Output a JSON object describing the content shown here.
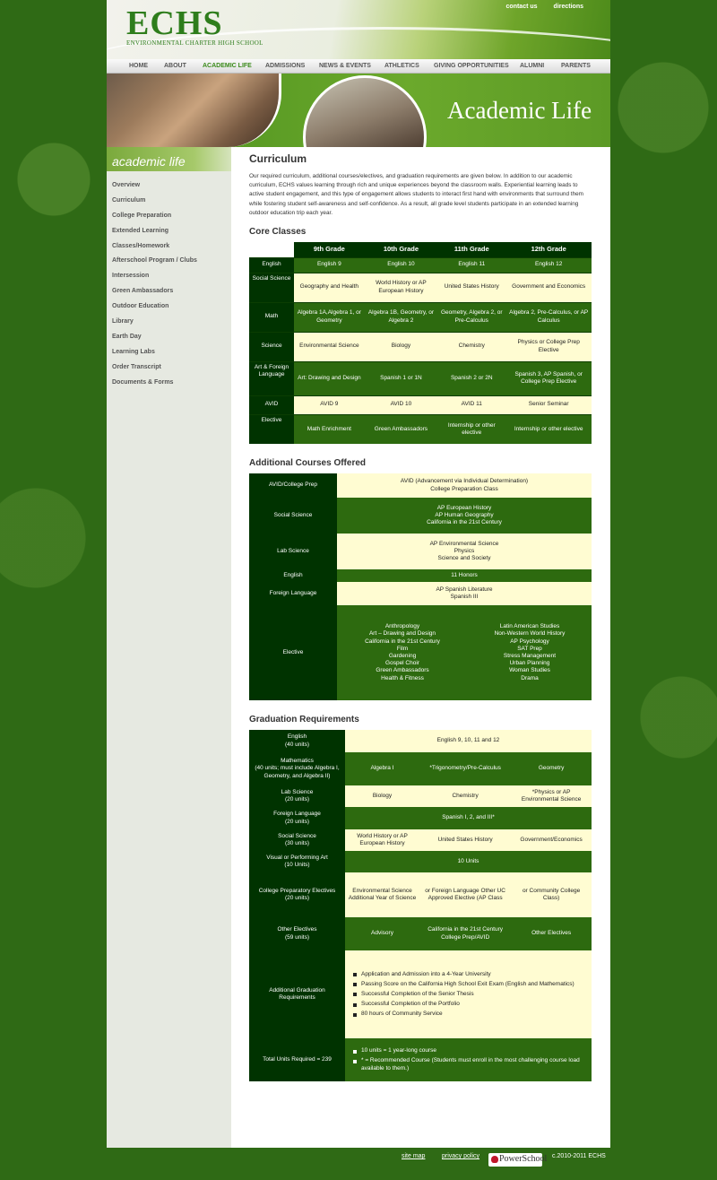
{
  "header": {
    "logo_text": "ECHS",
    "logo_sub": "ENVIRONMENTAL CHARTER HIGH SCHOOL",
    "util_nav": [
      "contact us",
      "directions"
    ]
  },
  "nav": [
    "HOME",
    "ABOUT",
    "ACADEMIC LIFE",
    "ADMISSIONS",
    "NEWS & EVENTS",
    "ATHLETICS",
    "GIVING OPPORTUNITIES",
    "ALUMNI",
    "PARENTS"
  ],
  "banner": {
    "title": "Academic Life"
  },
  "sidebar": {
    "title": "academic life",
    "items": [
      "Overview",
      "Curriculum",
      "College Preparation",
      "Extended Learning",
      "Classes/Homework",
      "Afterschool Program / Clubs",
      "Intersession",
      "Green Ambassadors",
      "Outdoor Education",
      "Library",
      "Earth Day",
      "Learning Labs",
      "Order Transcript",
      "Documents & Forms"
    ]
  },
  "curriculum": {
    "title": "Curriculum",
    "intro": "Our required curriculum, additional courses/electives, and graduation requirements are given below. In addition to our academic curriculum, ECHS values learning through rich and unique experiences beyond the classroom walls.   Experiential learning leads to active student engagement, and this type of engagement allows students to interact first hand with environments that surround them while fostering student self-awareness and self-confidence. As a result, all grade level students participate in an extended learning outdoor education trip each year."
  },
  "core": {
    "title": "Core Classes",
    "grades": [
      "9th Grade",
      "10th Grade",
      "11th Grade",
      "12th Grade"
    ],
    "rows": [
      {
        "subject": "English",
        "cells": [
          "English 9",
          "English 10",
          "English 11",
          "English 12"
        ]
      },
      {
        "subject": "Social Science",
        "cells": [
          "Geography and Health",
          "World History or AP European History",
          "United States History",
          "Government and Economics"
        ]
      },
      {
        "subject": "Math",
        "cells": [
          "Algebra 1A,Algebra 1, or Geometry",
          "Algebra 1B, Geometry, or Algebra 2",
          "Geometry, Algebra 2, or Pre-Calculus",
          "Algebra 2, Pre-Calculus, or AP Calculus"
        ]
      },
      {
        "subject": "Science",
        "cells": [
          "Environmental Science",
          "Biology",
          "Chemistry",
          "Physics or College Prep Elective"
        ]
      },
      {
        "subject": "Art & Foreign Language",
        "cells": [
          "Art: Drawing and Design",
          "Spanish 1 or 1N",
          "Spanish 2 or 2N",
          "Spanish 3, AP Spanish, or College Prep Elective"
        ]
      },
      {
        "subject": "AVID",
        "cells": [
          "AVID 9",
          "AVID 10",
          "AVID 11",
          "Senior Seminar"
        ]
      },
      {
        "subject": "Elective",
        "cells": [
          "Math Enrichment",
          "Green Ambassadors",
          "Internship or other elective",
          "Internship or other elective"
        ]
      }
    ]
  },
  "additional": {
    "title": "Additional Courses Offered",
    "avid_label": "AVID/College Prep",
    "avid_1": "AVID (Advancement via Individual Determination)",
    "avid_2": "College Preparation Class",
    "ss_label": "Social Science",
    "ss_1": "AP European History",
    "ss_2": "AP Human Geography",
    "ss_3": "California in the 21st Century",
    "lab_label": "Lab Science",
    "lab_1": "AP Environmental Science",
    "lab_2": "Physics",
    "lab_3": "Science and Society",
    "eng_label": "English",
    "eng_1": "11 Honors",
    "fl_label": "Foreign Language",
    "fl_1": "AP Spanish Literature",
    "fl_2": "Spanish III",
    "el_label": "Elective",
    "elective_left": [
      "Anthropology",
      "Art – Drawing and Design",
      "California in the 21st Century",
      "Film",
      "Gardening",
      "Gospel Choir",
      "Green Ambassadors",
      "Health & Fitness"
    ],
    "elective_right": [
      "Latin American Studies",
      "Non-Western World History",
      "AP Psychology",
      "SAT Prep",
      "Stress Management",
      "Urban Planning",
      "Woman Studies",
      "Drama"
    ]
  },
  "grad": {
    "title": "Graduation Requirements",
    "english_label": "English",
    "english_units": "(40 units)",
    "english_val": "English 9, 10, 11 and 12",
    "math_label": "Mathematics",
    "math_units": "(40 units; must include Algebra I, Geometry, and Algebra II)",
    "math_1": "Algebra I",
    "math_2": "*Trigonometry/Pre-Calculus",
    "math_3": "Geometry",
    "lab_label": "Lab Science",
    "lab_units": "(20 units)",
    "lab_1": "Biology",
    "lab_2": "Chemistry",
    "lab_3": "*Physics or AP Environmental Science",
    "fl_label": "Foreign Language",
    "fl_units": "(20 units)",
    "fl_val": "Spanish I, 2, and III*",
    "ss_label": "Social Science",
    "ss_units": "(30 units)",
    "ss_1": "World History or AP European History",
    "ss_2": "United States History",
    "ss_3": "Government/Economics",
    "vpa_label": "Visual or Performing Art",
    "vpa_units": "(10 Units)",
    "vpa_val": "10 Units",
    "cpe_label": "College Preparatory Electives",
    "cpe_units": "(20 units)",
    "cpe_1": "Environmental Science Additional Year of Science",
    "cpe_2": "or Foreign Language Other UC Approved Elective (AP Class",
    "cpe_3": "or Community College Class)",
    "oe_label": "Other Electives",
    "oe_units": "(59 units)",
    "oe_1": "Advisory",
    "oe_2a": "California in the 21st Century",
    "oe_2b": "College Prep/AVID",
    "oe_3": "Other Electives",
    "agr_label": "Additional Graduation Requirements",
    "agr_items": [
      "Application and Admission into a 4-Year University",
      "Passing Score on the California High School Exit Exam (English and Mathematics)",
      "Successful Completion of the Senior Thesis",
      "Successful Completion of the Portfolio",
      "80 hours of Community Service"
    ],
    "total_label": "Total Units Required = 239",
    "total_items": [
      "10 units = 1 year-long course",
      "* = Recommended Course (Students must enroll in the most challenging course load available to them.)"
    ]
  },
  "footer": {
    "sitemap": "site map",
    "privacy": "privacy policy",
    "powerschool": "PowerSchool",
    "copyright": "c.2010-2011 ECHS"
  }
}
